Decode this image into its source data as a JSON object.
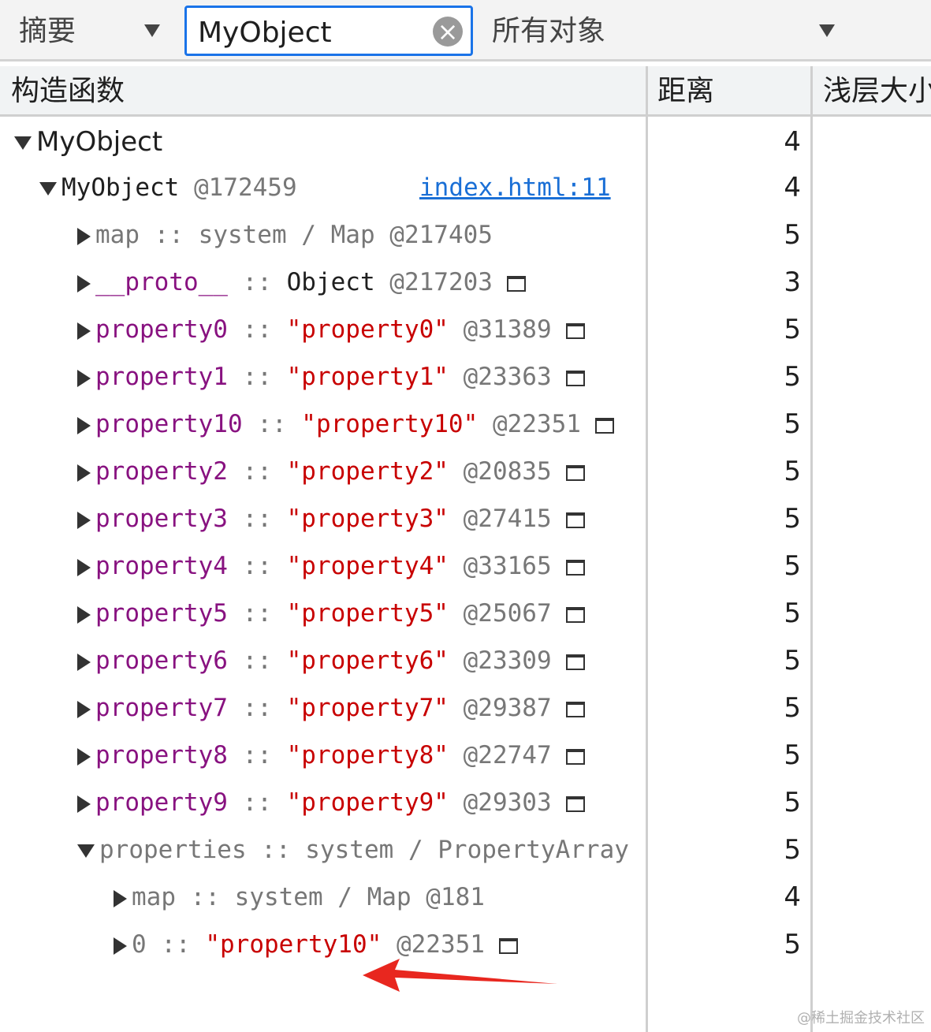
{
  "toolbar": {
    "view": "摘要",
    "search_value": "MyObject",
    "filter": "所有对象"
  },
  "columns": {
    "constructor": "构造函数",
    "distance": "距离",
    "shallow_size": "浅层大小"
  },
  "rows": [
    {
      "key": "MyObject",
      "distance": "4"
    },
    {
      "key": "MyObject",
      "id": "@172459",
      "link": "index.html:11",
      "distance": "4"
    },
    {
      "key": "map",
      "sep": " :: ",
      "value": "system / Map",
      "id": "@217405",
      "distance": "5"
    },
    {
      "key": "__proto__",
      "sep": " :: ",
      "value": "Object",
      "id": "@217203",
      "distance": "3"
    },
    {
      "key": "property0",
      "sep": " :: ",
      "value": "\"property0\"",
      "id": "@31389",
      "distance": "5"
    },
    {
      "key": "property1",
      "sep": " :: ",
      "value": "\"property1\"",
      "id": "@23363",
      "distance": "5"
    },
    {
      "key": "property10",
      "sep": " :: ",
      "value": "\"property10\"",
      "id": "@22351",
      "distance": "5"
    },
    {
      "key": "property2",
      "sep": " :: ",
      "value": "\"property2\"",
      "id": "@20835",
      "distance": "5"
    },
    {
      "key": "property3",
      "sep": " :: ",
      "value": "\"property3\"",
      "id": "@27415",
      "distance": "5"
    },
    {
      "key": "property4",
      "sep": " :: ",
      "value": "\"property4\"",
      "id": "@33165",
      "distance": "5"
    },
    {
      "key": "property5",
      "sep": " :: ",
      "value": "\"property5\"",
      "id": "@25067",
      "distance": "5"
    },
    {
      "key": "property6",
      "sep": " :: ",
      "value": "\"property6\"",
      "id": "@23309",
      "distance": "5"
    },
    {
      "key": "property7",
      "sep": " :: ",
      "value": "\"property7\"",
      "id": "@29387",
      "distance": "5"
    },
    {
      "key": "property8",
      "sep": " :: ",
      "value": "\"property8\"",
      "id": "@22747",
      "distance": "5"
    },
    {
      "key": "property9",
      "sep": " :: ",
      "value": "\"property9\"",
      "id": "@29303",
      "distance": "5"
    },
    {
      "key": "properties",
      "sep": " :: ",
      "value": "system / PropertyArray",
      "distance": "5"
    },
    {
      "key": "map",
      "sep": " :: ",
      "value": "system / Map",
      "id": "@181",
      "distance": "4"
    },
    {
      "key": "0",
      "sep": " :: ",
      "value": "\"property10\"",
      "id": "@22351",
      "distance": "5"
    }
  ],
  "watermark": "@稀土掘金技术社区",
  "colors": {
    "accent": "#1a73e8",
    "property_key": "#881280",
    "string_value": "#c80000",
    "annotation_arrow": "#e8271f"
  }
}
